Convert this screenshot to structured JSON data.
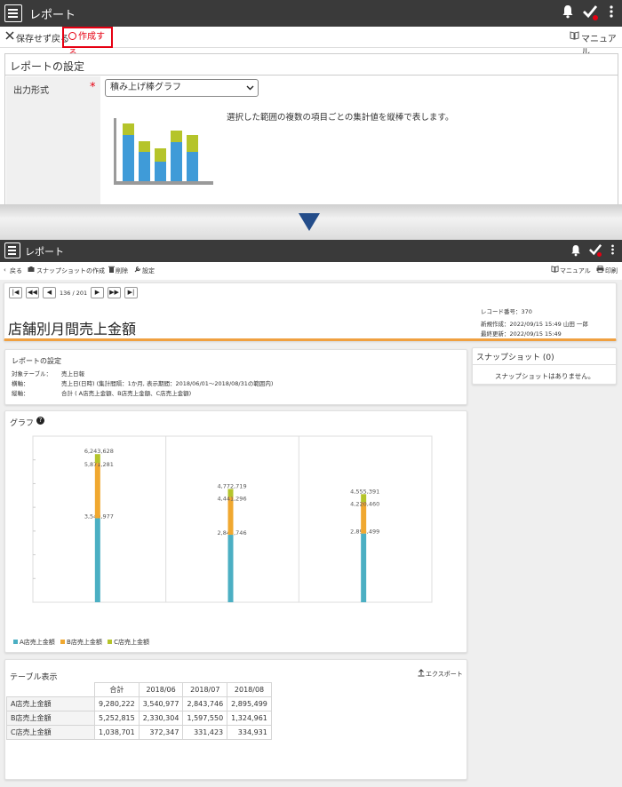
{
  "top": {
    "title": "レポート",
    "subbar": {
      "back_label": "保存せず戻る",
      "create_label": "作成する",
      "manual_label": "マニュアル"
    },
    "settings": {
      "heading": "レポートの設定",
      "output_label": "出力形式",
      "required_mark": "*",
      "select_value": "積み上げ棒グラフ",
      "description": "選択した範囲の複数の項目ごとの集計値を縦棒で表します。"
    }
  },
  "bottom": {
    "title": "レポート",
    "toolbar": {
      "back": "戻る",
      "snapshot": "スナップショットの作成",
      "delete": "削除",
      "settings": "設定",
      "manual": "マニュアル",
      "print": "印刷"
    },
    "pager": {
      "first": "|◀",
      "prev_fast": "◀◀",
      "prev": "◀",
      "position": "136 / 201",
      "next": "▶",
      "next_fast": "▶▶",
      "last": "▶|"
    },
    "record": {
      "title": "店舗別月間売上金額",
      "record_no": "レコード番号：370",
      "created": "新規作成：2022/09/15 15:49 山田 一郎",
      "updated": "最終更新：2022/09/15 15:49"
    },
    "report_settings": {
      "heading": "レポートの設定",
      "target_label": "対象テーブル：",
      "target_value": "売上日報",
      "xaxis_label": "横軸：",
      "xaxis_value": "売上日(日時) (集計間隔：1か月, 表示期間：2018/06/01～2018/08/31の範囲内)",
      "yaxis_label": "縦軸：",
      "yaxis_value": "合計 ( A店売上金額、B店売上金額、C店売上金額)"
    },
    "snapshot": {
      "heading": "スナップショット (0)",
      "empty": "スナップショットはありません。"
    },
    "graph": {
      "heading": "グラフ",
      "help": "?"
    },
    "table": {
      "heading": "テーブル表示",
      "export": "エクスポート",
      "columns": [
        "",
        "合計",
        "2018/06",
        "2018/07",
        "2018/08"
      ],
      "rows": [
        [
          "A店売上金額",
          "9,280,222",
          "3,540,977",
          "2,843,746",
          "2,895,499"
        ],
        [
          "B店売上金額",
          "5,252,815",
          "2,330,304",
          "1,597,550",
          "1,324,961"
        ],
        [
          "C店売上金額",
          "1,038,701",
          "372,347",
          "331,423",
          "334,931"
        ]
      ]
    }
  },
  "colors": {
    "a": "#4bafc3",
    "b": "#f0a830",
    "c": "#b5c42a",
    "accent": "#f0a040",
    "red": "#e60012"
  },
  "chart_data": {
    "type": "bar",
    "stacked": true,
    "categories": [
      "2018/06",
      "2018/07",
      "2018/08"
    ],
    "series": [
      {
        "name": "A店売上金額",
        "values": [
          3540977,
          2843746,
          2895499
        ]
      },
      {
        "name": "B店売上金額",
        "values": [
          2330304,
          1597550,
          1324961
        ]
      },
      {
        "name": "C店売上金額",
        "values": [
          372347,
          331423,
          334931
        ]
      }
    ],
    "data_labels": [
      [
        "3,540,977",
        "5,871,281",
        "6,243,628"
      ],
      [
        "2,843,746",
        "4,441,296",
        "4,772,719"
      ],
      [
        "2,895,499",
        "4,220,460",
        "4,555,391"
      ]
    ],
    "ylim": [
      0,
      7000000
    ],
    "grid": true,
    "legend": "bottom-left"
  }
}
